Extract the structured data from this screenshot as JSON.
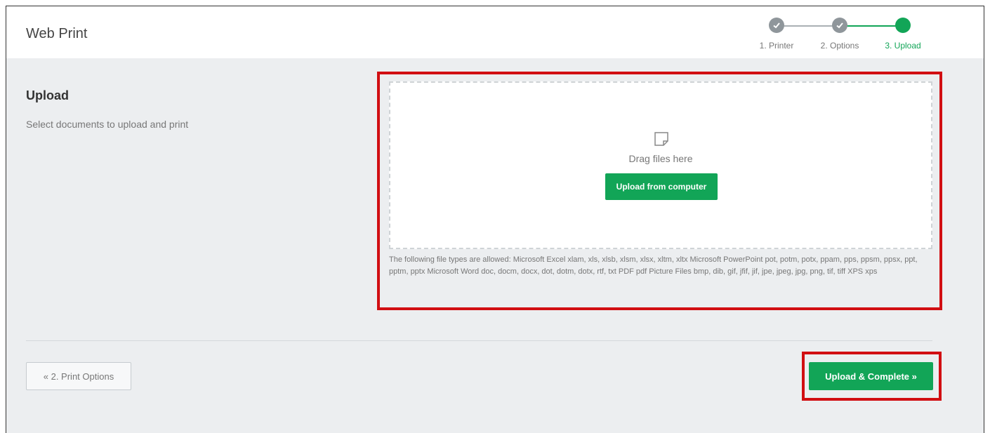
{
  "app": {
    "title": "Web Print"
  },
  "stepper": {
    "steps": [
      {
        "label": "1. Printer",
        "state": "done"
      },
      {
        "label": "2. Options",
        "state": "done"
      },
      {
        "label": "3. Upload",
        "state": "active"
      }
    ]
  },
  "upload": {
    "title": "Upload",
    "description": "Select documents to upload and print",
    "drag_text": "Drag files here",
    "button_label": "Upload from computer",
    "file_types_text": "The following file types are allowed: Microsoft Excel xlam, xls, xlsb, xlsm, xlsx, xltm, xltx Microsoft PowerPoint pot, potm, potx, ppam, pps, ppsm, ppsx, ppt, pptm, pptx Microsoft Word doc, docm, docx, dot, dotm, dotx, rtf, txt PDF pdf Picture Files bmp, dib, gif, jfif, jif, jpe, jpeg, jpg, png, tif, tiff XPS xps"
  },
  "footer": {
    "prev_label": "« 2. Print Options",
    "complete_label": "Upload & Complete »"
  },
  "colors": {
    "accent": "#12a557",
    "highlight": "#d10e12",
    "step_done": "#8f969b",
    "background": "#eceef0"
  }
}
